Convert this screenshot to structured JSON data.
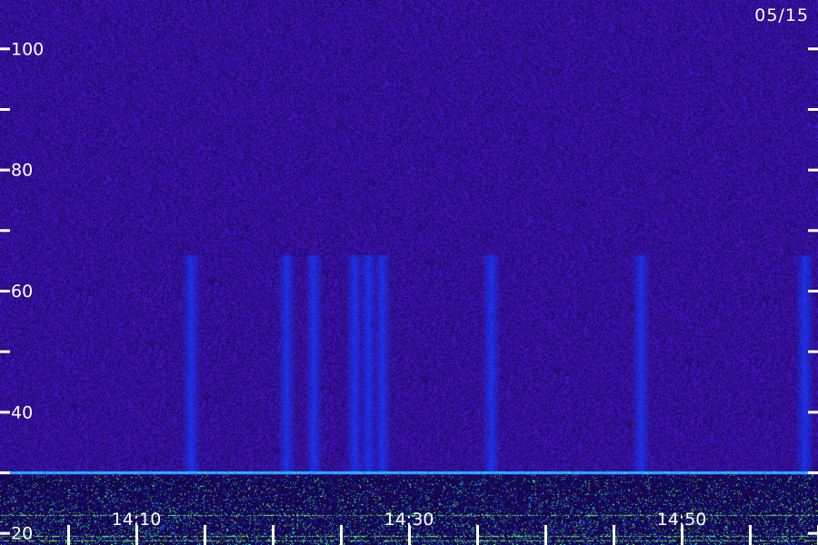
{
  "date_label": "05/15",
  "chart_data": {
    "type": "heatmap",
    "title": "",
    "xlabel": "",
    "ylabel": "",
    "y_ticks": [
      20,
      30,
      40,
      50,
      60,
      70,
      80,
      90,
      100
    ],
    "y_tick_labels": [
      "20",
      "",
      "40",
      "",
      "60",
      "",
      "80",
      "",
      "100"
    ],
    "ylim": [
      18,
      108
    ],
    "x_ticks": [
      "14:05",
      "14:10",
      "14:15",
      "14:20",
      "14:25",
      "14:30",
      "14:35",
      "14:40",
      "14:45",
      "14:50",
      "14:55",
      "15:00"
    ],
    "x_tick_labels": [
      "",
      "14:10",
      "",
      "",
      "",
      "14:30",
      "",
      "",
      "",
      "14:50",
      "",
      ""
    ],
    "xlim": [
      "14:00",
      "15:00"
    ],
    "features": {
      "horizontal_band_value": 30,
      "vertical_bursts_times": [
        "14:14",
        "14:21",
        "14:23",
        "14:26",
        "14:27",
        "14:28",
        "14:36",
        "14:47",
        "14:59"
      ],
      "background_color": "#2a0a66",
      "signal_colors": [
        "#1e32ff",
        "#00ffd0",
        "#7cff30"
      ]
    }
  }
}
